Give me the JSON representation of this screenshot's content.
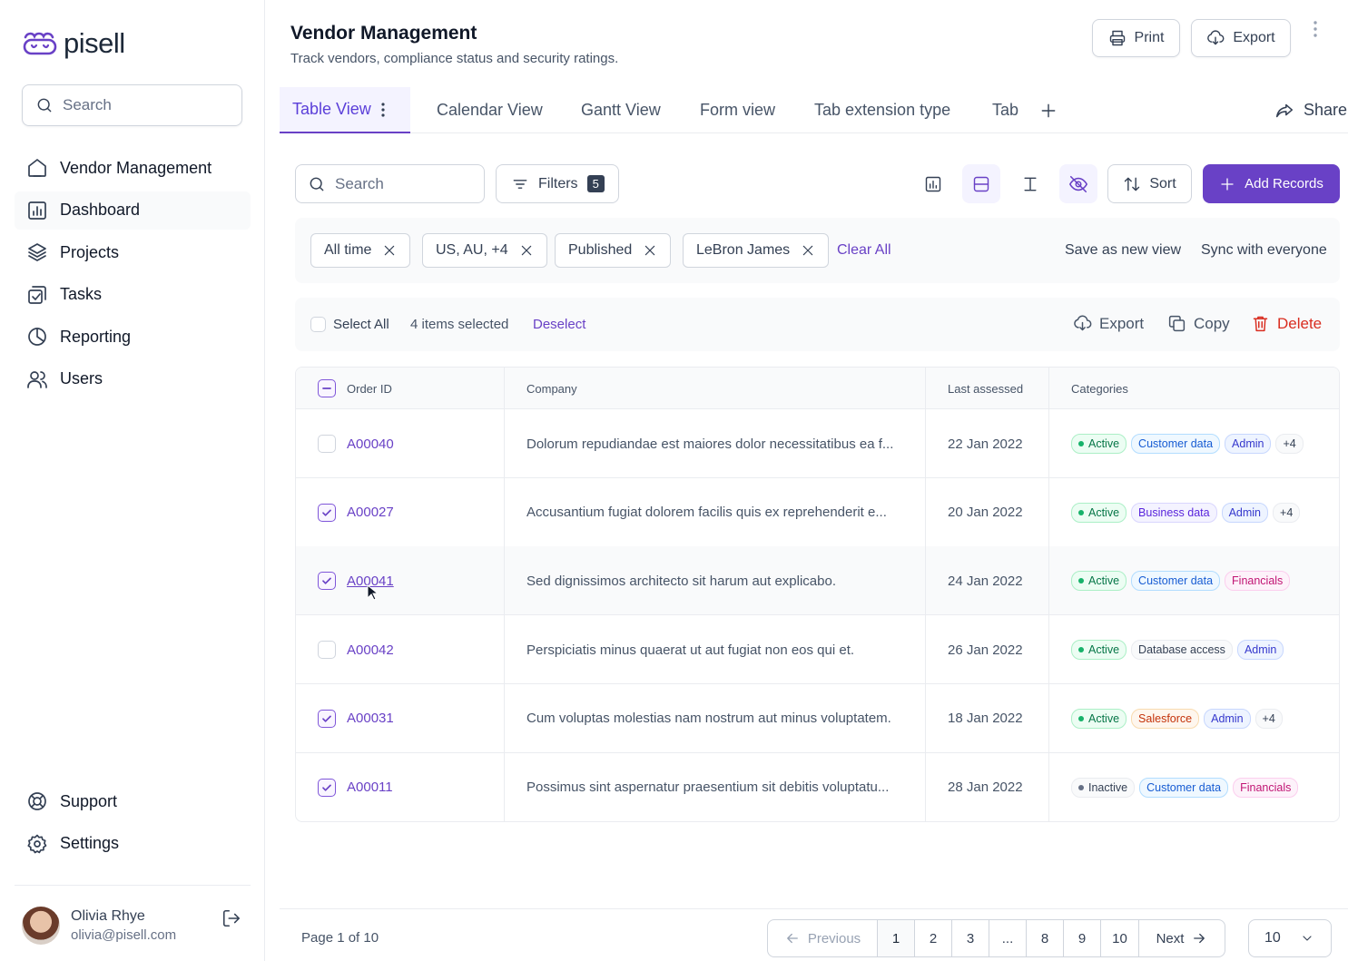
{
  "app": {
    "logo_text": "pisell"
  },
  "sidebar": {
    "search_placeholder": "Search",
    "items": [
      {
        "label": "Vendor Management",
        "icon": "home-icon"
      },
      {
        "label": "Dashboard",
        "icon": "bar-chart-icon",
        "active": true
      },
      {
        "label": "Projects",
        "icon": "layers-icon"
      },
      {
        "label": "Tasks",
        "icon": "check-square-icon"
      },
      {
        "label": "Reporting",
        "icon": "pie-chart-icon"
      },
      {
        "label": "Users",
        "icon": "users-icon"
      }
    ],
    "bottom_items": [
      {
        "label": "Support",
        "icon": "life-buoy-icon"
      },
      {
        "label": "Settings",
        "icon": "gear-icon"
      }
    ],
    "user": {
      "name": "Olivia Rhye",
      "email": "olivia@pisell.com"
    }
  },
  "header": {
    "title": "Vendor Management",
    "subtitle": "Track vendors, compliance status and security ratings.",
    "print_label": "Print",
    "export_label": "Export"
  },
  "tabs": [
    "Table View",
    "Calendar View",
    "Gantt View",
    "Form view",
    "Tab extension type",
    "Tab"
  ],
  "share_label": "Share",
  "toolbar": {
    "search_placeholder": "Search",
    "filters_label": "Filters",
    "filters_count": "5",
    "sort_label": "Sort",
    "add_label": "Add Records"
  },
  "active_filters": [
    "All time",
    "US, AU, +4",
    "Published",
    "LeBron James"
  ],
  "filter_actions": {
    "clear_all": "Clear All",
    "save_view": "Save as new view",
    "sync": "Sync with everyone"
  },
  "selection": {
    "select_all": "Select All",
    "count_text": "4 items selected",
    "deselect": "Deselect",
    "export": "Export",
    "copy": "Copy",
    "delete": "Delete"
  },
  "table": {
    "columns": [
      "Order ID",
      "Company",
      "Last assessed",
      "Categories"
    ],
    "rows": [
      {
        "id": "A00040",
        "company": "Dolorum repudiandae est maiores dolor necessitatibus ea f...",
        "date": "22 Jan 2022",
        "checked": false,
        "tags": [
          {
            "t": "Active",
            "c": "active"
          },
          {
            "t": "Customer data",
            "c": "blue"
          },
          {
            "t": "Admin",
            "c": "indigo"
          },
          {
            "t": "+4",
            "c": "gray"
          }
        ]
      },
      {
        "id": "A00027",
        "company": "Accusantium fugiat dolorem facilis quis ex reprehenderit e...",
        "date": "20 Jan 2022",
        "checked": true,
        "tags": [
          {
            "t": "Active",
            "c": "active"
          },
          {
            "t": "Business data",
            "c": "purple"
          },
          {
            "t": "Admin",
            "c": "indigo"
          },
          {
            "t": "+4",
            "c": "gray"
          }
        ]
      },
      {
        "id": "A00041",
        "company": "Sed dignissimos architecto sit harum aut explicabo.",
        "date": "24 Jan 2022",
        "checked": true,
        "tags": [
          {
            "t": "Active",
            "c": "active"
          },
          {
            "t": "Customer data",
            "c": "blue"
          },
          {
            "t": "Financials",
            "c": "pink"
          }
        ]
      },
      {
        "id": "A00042",
        "company": "Perspiciatis minus quaerat ut aut fugiat non eos qui et.",
        "date": "26 Jan 2022",
        "checked": false,
        "tags": [
          {
            "t": "Active",
            "c": "active"
          },
          {
            "t": "Database access",
            "c": "gray"
          },
          {
            "t": "Admin",
            "c": "indigo"
          }
        ]
      },
      {
        "id": "A00031",
        "company": "Cum voluptas molestias nam nostrum aut minus voluptatem.",
        "date": "18 Jan 2022",
        "checked": true,
        "tags": [
          {
            "t": "Active",
            "c": "active"
          },
          {
            "t": "Salesforce",
            "c": "orange"
          },
          {
            "t": "Admin",
            "c": "indigo"
          },
          {
            "t": "+4",
            "c": "gray"
          }
        ]
      },
      {
        "id": "A00011",
        "company": "Possimus sint aspernatur praesentium sit debitis voluptatu...",
        "date": "28 Jan 2022",
        "checked": true,
        "tags": [
          {
            "t": "Inactive",
            "c": "inactive"
          },
          {
            "t": "Customer data",
            "c": "blue"
          },
          {
            "t": "Financials",
            "c": "pink"
          }
        ]
      }
    ]
  },
  "pagination": {
    "page_info": "Page 1 of 10",
    "previous": "Previous",
    "next": "Next",
    "pages": [
      "1",
      "2",
      "3",
      "...",
      "8",
      "9",
      "10"
    ],
    "per_page": "10"
  },
  "colors": {
    "accent": "#6941c6",
    "danger": "#d92d20"
  }
}
